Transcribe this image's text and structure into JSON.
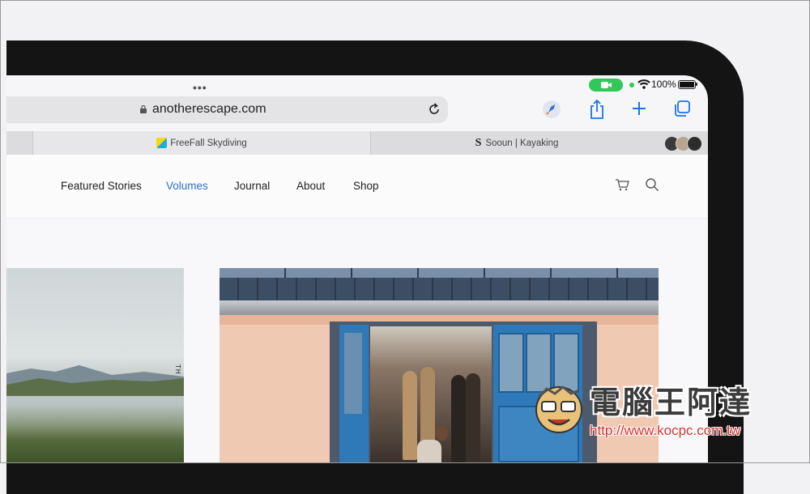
{
  "status_bar": {
    "battery_percent": "100%"
  },
  "browser": {
    "url": "anotherescape.com",
    "tabs": [
      {
        "title": "FreeFall Skydiving",
        "active": true
      },
      {
        "title": "Sooun | Kayaking",
        "active": false
      }
    ]
  },
  "site": {
    "nav": [
      {
        "label": "Featured Stories",
        "active": false
      },
      {
        "label": "Volumes",
        "active": true
      },
      {
        "label": "Journal",
        "active": false
      },
      {
        "label": "About",
        "active": false
      },
      {
        "label": "Shop",
        "active": false
      }
    ],
    "vertical_text": "TH"
  },
  "watermark": {
    "title": "電腦王阿達",
    "url": "http://www.kocpc.com.tw"
  },
  "colors": {
    "accent": "#2f6fd0",
    "facetime_green": "#32c759",
    "bezel": "#141414"
  }
}
